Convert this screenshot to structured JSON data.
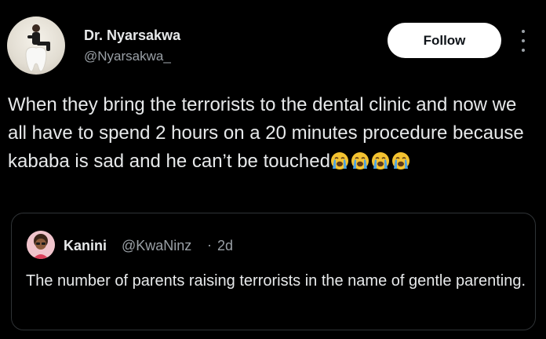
{
  "tweet": {
    "author_name": "Dr. Nyarsakwa",
    "author_handle": "@Nyarsakwa_",
    "follow_label": "Follow",
    "text": "When they bring the terrorists to the dental clinic and now we all have to spend 2 hours on a 20 minutes procedure because kababa is sad and he can’t be touched",
    "emojis": [
      "loudly-crying-face",
      "loudly-crying-face",
      "loudly-crying-face",
      "loudly-crying-face"
    ]
  },
  "quoted": {
    "author_name": "Kanini",
    "author_handle": "@KwaNinz",
    "separator": "·",
    "time": "2d",
    "text": "The number of parents raising terrorists in the name of gentle parenting."
  },
  "icons": {
    "more": "more-vertical-icon"
  },
  "colors": {
    "background": "#000000",
    "text": "#e7e9ea",
    "secondary_text": "#9aa0a6",
    "border": "#2f3336",
    "follow_bg": "#ffffff"
  }
}
